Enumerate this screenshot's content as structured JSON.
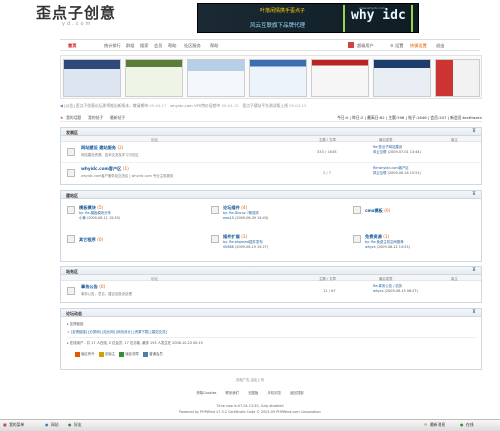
{
  "site": {
    "logo_text": "歪点子创意",
    "logo_sub": "yd.com",
    "banner_title": "叶落闲情携手歪点子",
    "banner_sub": "风云互联旗下品牌代理",
    "banner_brand": "why idc",
    "banner_brand_small": "www.whyidc.com"
  },
  "top_right": {
    "user": "超级用户",
    "links": [
      "设置",
      "快捷设置",
      "退出"
    ]
  },
  "nav": [
    "首页",
    "统计排行",
    "群组",
    "搜索",
    "会员",
    "帮助",
    "社区服务",
    "帮助"
  ],
  "ticker": [
    "[公告] 歪点子创意论坛即将推出新版本，敬请期待",
    "09-04-17",
    "whyidc.com VPS特价促销中",
    "09-04-15",
    "歪点子建站平台测试版上线",
    "09-04-13"
  ],
  "subbar": {
    "left": [
      "我的话题",
      "我的帖子",
      "最新帖子"
    ],
    "stats": "今日:0 | 昨日:2 | 最高日:62 | 主题:398 | 帖子:1646 | 会员:207 | 新会员:testfrozen"
  },
  "sections": [
    {
      "title": "发展区",
      "columns": [
        "论坛",
        "主题 / 文章",
        "最后发表",
        "版主"
      ],
      "forums": [
        {
          "name": "网站建设 建站服务",
          "count": "(2)",
          "desc": "网站建设资源、技术交流及学习讨论区",
          "stat": "333 / 1638",
          "last_title": "Re:歪点子网站建设",
          "last_by": "风云互联",
          "last_time": "2009-07-01 13:44"
        },
        {
          "name": "whyidc.com客户区",
          "count": "(1)",
          "desc": "whyidc.com客户服务及交流区 | whyidc.com 专业主机服务",
          "stat": "2 / 7",
          "last_title": "Re:whyidc.com客户区",
          "last_by": "风云互联",
          "last_time": "2009-06-18 15:51"
        }
      ]
    },
    {
      "title": "建站区",
      "forums": [
        {
          "name": "模板模块",
          "count": "(5)",
          "last_title": "by: Re:模板模块分享",
          "last_by": "小黄",
          "last_time": "2009-06-11 15:35"
        },
        {
          "name": "论坛插件",
          "count": "(4)",
          "last_title": "by: Re:Discuz 7新插件",
          "last_by": "ews15",
          "last_time": "2009-06-09 14:43"
        },
        {
          "name": "cms模板",
          "count": "(0)"
        },
        {
          "name": "其它程序",
          "count": "(0)",
          "last_title": "",
          "last_by": "",
          "last_time": ""
        },
        {
          "name": "插件扩展",
          "count": "(1)",
          "last_title": "by: Re:phpwind插件发布",
          "last_by": "00668",
          "last_time": "2009-06-19 15:27"
        },
        {
          "name": "免费资源",
          "count": "(1)",
          "last_title": "by: Re:免费主机空间推荐",
          "last_by": "whycs",
          "last_time": "2009-06-12 14:53"
        }
      ]
    },
    {
      "title": "站务区",
      "columns": [
        "论坛",
        "主题 / 文章",
        "最后发表",
        "版主"
      ],
      "forums": [
        {
          "name": "事务公告",
          "count": "(0)",
          "desc": "事务公告，意见，建议及投诉处理",
          "stat": "12 / 67",
          "last_title": "Re:事务公告 / 站务",
          "last_by": "whycs",
          "last_time": "2009-06-15 06:27"
        }
      ]
    }
  ],
  "online": {
    "title": "论坛动态",
    "sub": "友情链接",
    "links_line": "[友情链接] [分类网] [站长网] [网页设计] [资源下载] [建站交流]",
    "online_line": "在线用户 - 共 17 人在线, 0 位会员, 17 位访客, 最多 193 人发生在 2008-10-23 00:15",
    "legend": [
      "版区有令",
      "总版主",
      "版区领导",
      "普通会员"
    ]
  },
  "ad": "页面广告 由此上传",
  "footer_links": [
    "清除Cookies",
    "联系我们",
    "无图版",
    "手机浏览",
    "返回顶部"
  ],
  "footer_lines": [
    "Time now is:07-04 13:30, Gzip disabled",
    "Powered by PHPWind v7.3.2 Certificate Code © 2003-09 PHPWind.com Corporation"
  ],
  "taskbar": [
    "我的菜单",
    "网站",
    "好友",
    "最新消息",
    "在线"
  ],
  "colors": {
    "accent": "#cc0000",
    "link": "#1a5a9a",
    "count": "#e05a00",
    "border": "#cfd8e0"
  }
}
